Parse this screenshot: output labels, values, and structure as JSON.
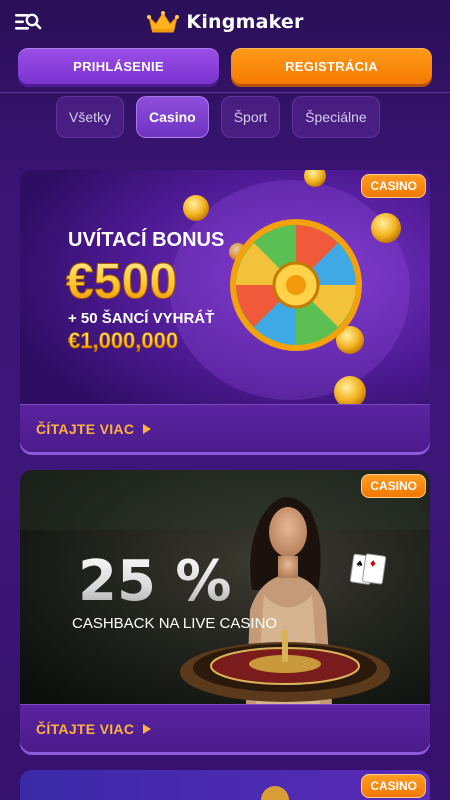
{
  "header": {
    "logo_text": "Kingmaker",
    "menu_icon": "menu-search-icon",
    "logo_icon": "crown-icon"
  },
  "auth": {
    "login_label": "PRIHLÁSENIE",
    "register_label": "REGISTRÁCIA"
  },
  "tabs": [
    {
      "label": "Všetky",
      "active": false
    },
    {
      "label": "Casino",
      "active": true
    },
    {
      "label": "Šport",
      "active": false
    },
    {
      "label": "Špeciálne",
      "active": false
    }
  ],
  "promos": [
    {
      "badge": "CASINO",
      "banner": {
        "line1": "UVÍTACÍ BONUS",
        "amount": "€500",
        "line3": "+ 50 ŠANCÍ VYHRÁŤ",
        "jackpot": "€1,000,000"
      },
      "cta": "ČÍTAJTE VIAC"
    },
    {
      "badge": "CASINO",
      "banner": {
        "percent": "25 %",
        "subtitle": "CASHBACK NA LIVE CASINO"
      },
      "cta": "ČÍTAJTE VIAC"
    },
    {
      "badge": "CASINO"
    }
  ],
  "colors": {
    "accent_orange": "#f57a00",
    "accent_purple": "#7b33d1",
    "cta_text": "#ffb23a",
    "background": "#3a1575"
  }
}
